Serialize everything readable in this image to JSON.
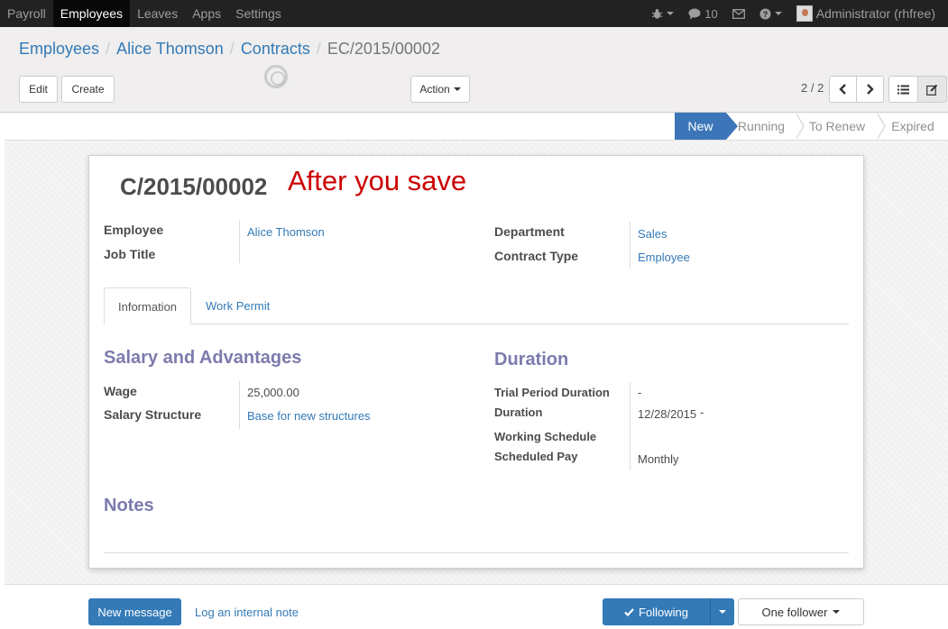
{
  "topbar": {
    "menu": [
      "Payroll",
      "Employees",
      "Leaves",
      "Apps",
      "Settings"
    ],
    "active_menu": "Employees",
    "messages_count": "10",
    "user": "Administrator (rhfree)",
    "icons": [
      "bug-icon",
      "chat-icon",
      "envelope-icon",
      "help-icon"
    ]
  },
  "breadcrumb": {
    "items": [
      "Employees",
      "Alice Thomson",
      "Contracts"
    ],
    "current": "EC/2015/00002"
  },
  "buttons": {
    "edit": "Edit",
    "create": "Create",
    "action": "Action"
  },
  "pager": {
    "value": "2 / 2"
  },
  "statusbar": {
    "stages": [
      "New",
      "Running",
      "To Renew",
      "Expired"
    ],
    "active": "New"
  },
  "form": {
    "name": "C/2015/00002",
    "overlay_note": "After you save",
    "labels": {
      "employee": "Employee",
      "job_title": "Job Title",
      "department": "Department",
      "contract_type": "Contract Type",
      "wage": "Wage",
      "salary_structure": "Salary Structure",
      "trial_period": "Trial Period Duration",
      "duration": "Duration",
      "working_schedule": "Working Schedule",
      "scheduled_pay": "Scheduled Pay"
    },
    "values": {
      "employee": "Alice Thomson",
      "job_title": "",
      "department": "Sales",
      "contract_type": "Employee",
      "wage": "25,000.00",
      "salary_structure": "Base for new structures",
      "trial_period": "-",
      "duration_start": "12/28/2015",
      "duration_sep": "-",
      "working_schedule": "",
      "scheduled_pay": "Monthly"
    },
    "tabs": [
      "Information",
      "Work Permit"
    ],
    "active_tab": "Information",
    "groups": {
      "salary": "Salary and Advantages",
      "duration": "Duration",
      "notes": "Notes"
    }
  },
  "chatter": {
    "new_message": "New message",
    "log_note": "Log an internal note",
    "following": "Following",
    "followers": "One follower"
  },
  "colors": {
    "navbar": "#222222",
    "accent": "#337ab7",
    "status_active": "#3c76b9",
    "group_title": "#7c7bad",
    "overlay_note": "#cc0000"
  }
}
